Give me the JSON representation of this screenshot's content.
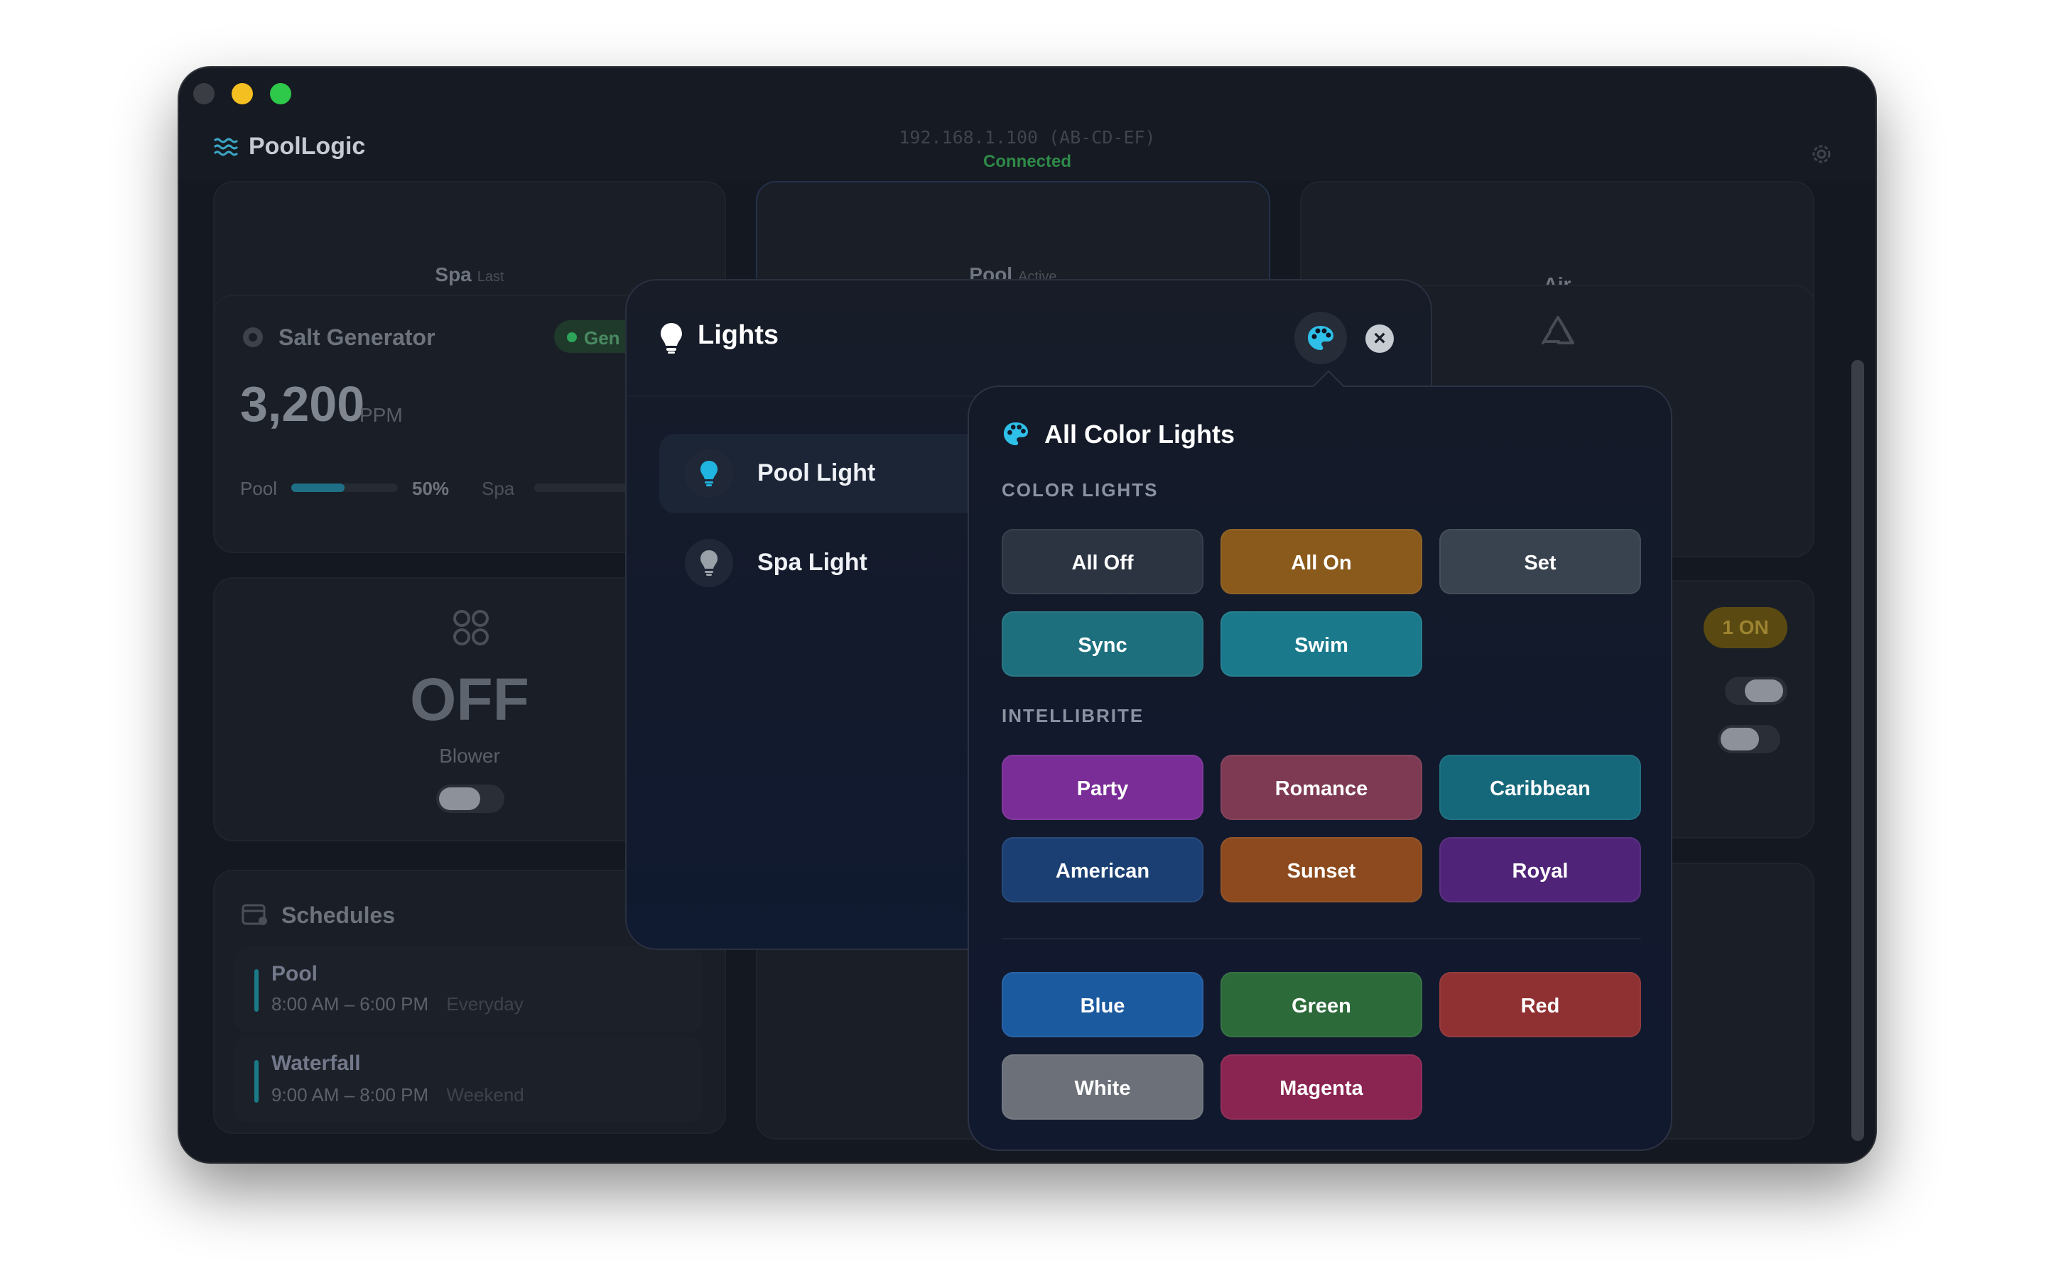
{
  "app": {
    "name": "PoolLogic",
    "ip": "192.168.1.100 (AB-CD-EF)",
    "status": "Connected"
  },
  "tabs": [
    {
      "label": "Spa",
      "sub": "Last"
    },
    {
      "label": "Pool",
      "sub": "Active"
    },
    {
      "label": "Air",
      "sub": ""
    }
  ],
  "salt": {
    "title": "Salt Generator",
    "badge": "Gen",
    "value": "3,200",
    "unit": "PPM",
    "pool_label": "Pool",
    "pool_pct": "50%",
    "pool_fill": 0.5,
    "spa_label": "Spa"
  },
  "blower": {
    "state": "OFF",
    "label": "Blower"
  },
  "schedules": {
    "title": "Schedules",
    "items": [
      {
        "name": "Pool",
        "time": "8:00 AM – 6:00 PM",
        "days": "Everyday"
      },
      {
        "name": "Waterfall",
        "time": "9:00 AM – 8:00 PM",
        "days": "Weekend"
      }
    ]
  },
  "right_card": {
    "badge": "1 ON"
  },
  "lights": {
    "title": "Lights",
    "items": [
      {
        "name": "Pool Light"
      },
      {
        "name": "Spa Light"
      }
    ]
  },
  "popover": {
    "title": "All Color Lights",
    "section_color": "COLOR LIGHTS",
    "section_intellibrite": "INTELLIBRITE",
    "color_buttons": [
      {
        "label": "All Off",
        "color": "#2c3442"
      },
      {
        "label": "All On",
        "color": "#8a5a1c"
      },
      {
        "label": "Set",
        "color": "#39434f"
      },
      {
        "label": "Sync",
        "color": "#1e6f7e"
      },
      {
        "label": "Swim",
        "color": "#1a7a8c"
      }
    ],
    "intellibrite_buttons": [
      {
        "label": "Party",
        "color": "#7a2d96"
      },
      {
        "label": "Romance",
        "color": "#7d3a52"
      },
      {
        "label": "Caribbean",
        "color": "#15687a"
      },
      {
        "label": "American",
        "color": "#1b3f72"
      },
      {
        "label": "Sunset",
        "color": "#8c4a1e"
      },
      {
        "label": "Royal",
        "color": "#4f2478"
      }
    ],
    "solid_buttons": [
      {
        "label": "Blue",
        "color": "#1c5aa0"
      },
      {
        "label": "Green",
        "color": "#2c6a3a"
      },
      {
        "label": "Red",
        "color": "#8f3032"
      },
      {
        "label": "White",
        "color": "#6c7079"
      },
      {
        "label": "Magenta",
        "color": "#8a2450"
      }
    ]
  }
}
